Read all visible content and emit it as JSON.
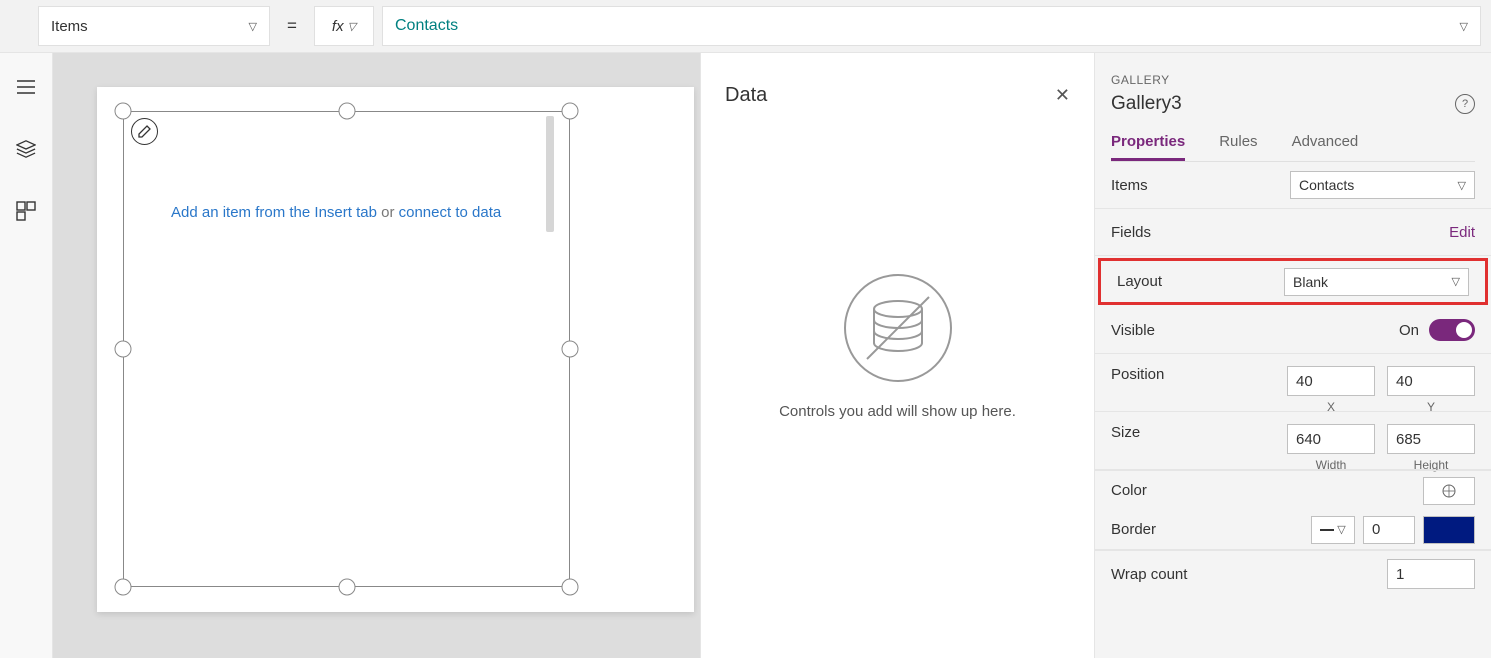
{
  "formula": {
    "property": "Items",
    "fx_label": "fx",
    "value": "Contacts"
  },
  "canvas": {
    "hint_link1": "Add an item from the Insert tab",
    "hint_mid": " or ",
    "hint_link2": "connect to data"
  },
  "dataPanel": {
    "title": "Data",
    "empty_msg": "Controls you add will show up here."
  },
  "props": {
    "category": "GALLERY",
    "name": "Gallery3",
    "tabs": {
      "properties": "Properties",
      "rules": "Rules",
      "advanced": "Advanced"
    },
    "items_label": "Items",
    "items_value": "Contacts",
    "fields_label": "Fields",
    "fields_edit": "Edit",
    "layout_label": "Layout",
    "layout_value": "Blank",
    "visible_label": "Visible",
    "visible_state": "On",
    "position_label": "Position",
    "pos_x": "40",
    "pos_y": "40",
    "pos_x_label": "X",
    "pos_y_label": "Y",
    "size_label": "Size",
    "size_w": "640",
    "size_h": "685",
    "size_w_label": "Width",
    "size_h_label": "Height",
    "color_label": "Color",
    "border_label": "Border",
    "border_width": "0",
    "wrap_label": "Wrap count",
    "wrap_value": "1"
  }
}
